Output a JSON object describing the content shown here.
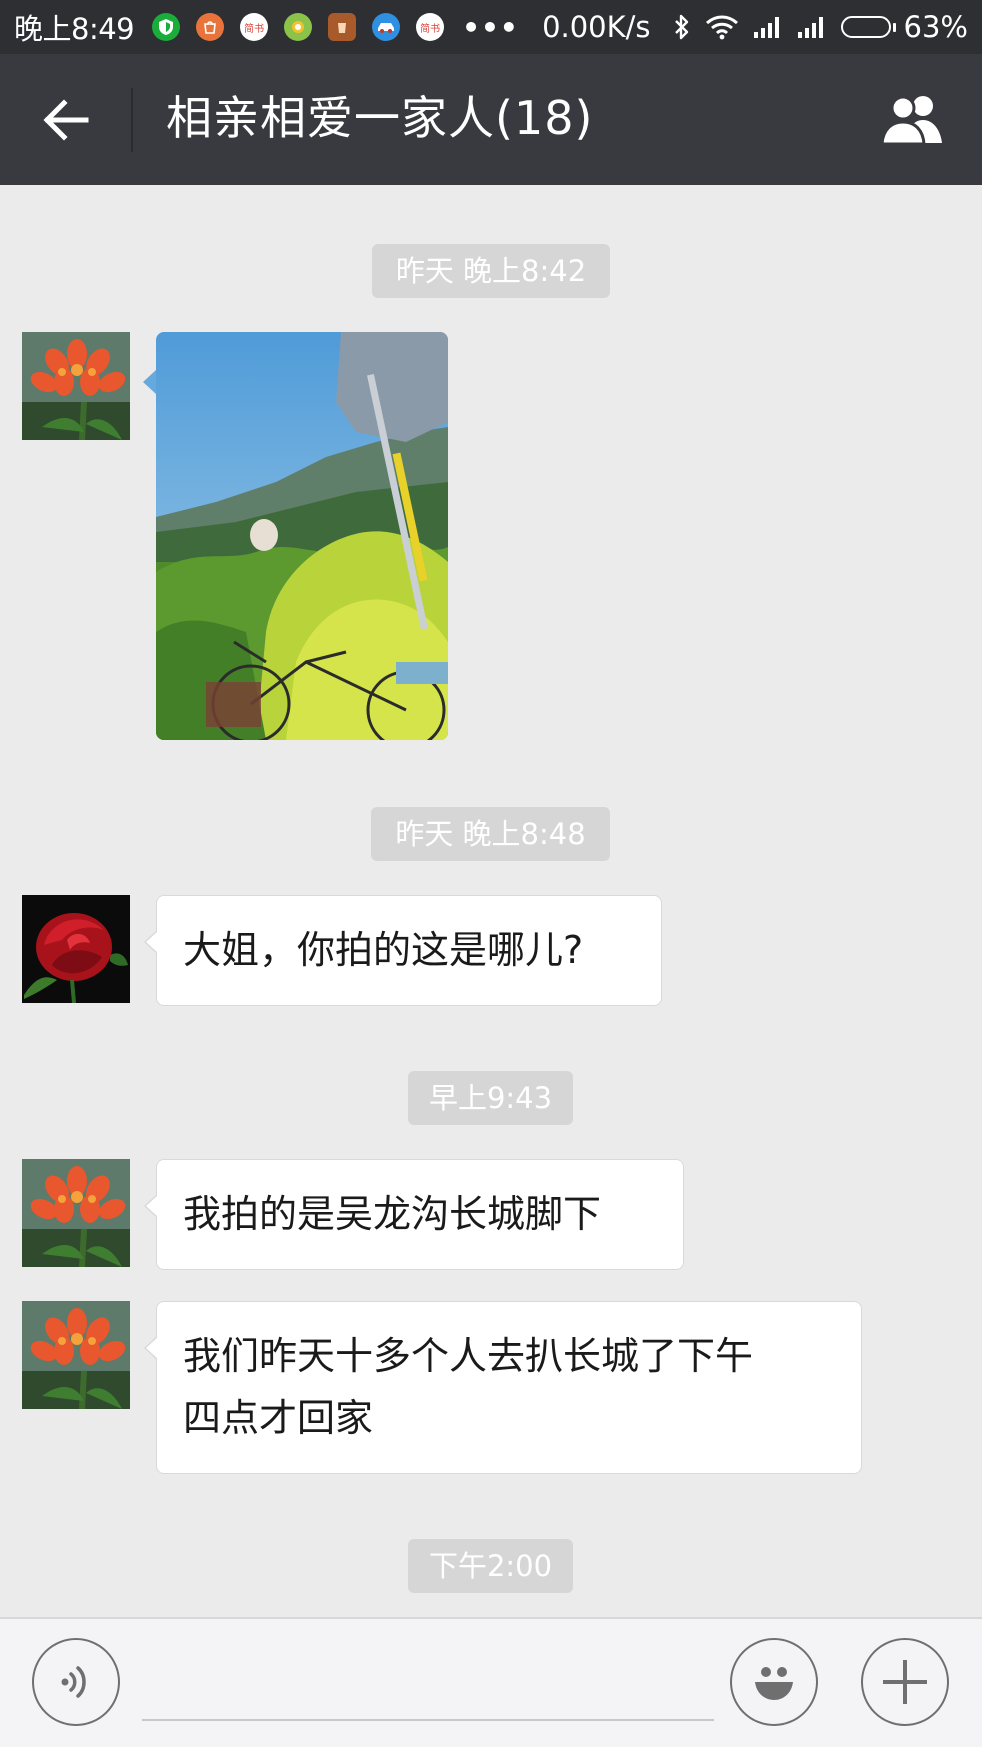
{
  "status_bar": {
    "time": "晚上8:49",
    "notification_icons": [
      {
        "icon": "shield-app-icon",
        "color": "#1aad3a",
        "label": ""
      },
      {
        "icon": "shopping-app-icon",
        "color": "#e8743b",
        "label": ""
      },
      {
        "icon": "jianshu-app-icon",
        "color": "#ffffff",
        "label": "简书"
      },
      {
        "icon": "circle-app-icon",
        "color": "#f2c12e",
        "label": ""
      },
      {
        "icon": "cup-app-icon",
        "color": "#d46a2b",
        "label": ""
      },
      {
        "icon": "car-app-icon",
        "color": "#2f8fe0",
        "label": ""
      },
      {
        "icon": "jianshu-app-icon",
        "color": "#ffffff",
        "label": "简书"
      }
    ],
    "more": "•••",
    "network_speed": "0.00K/s",
    "bluetooth_icon": "bluetooth-icon",
    "wifi_icon": "wifi-icon",
    "signal_icons": [
      "signal-icon",
      "signal-icon"
    ],
    "battery_level": 0.63,
    "battery_percent": "63%"
  },
  "header": {
    "back_icon": "arrow-left-icon",
    "title": "相亲相爱一家人(18)",
    "members_icon": "group-members-icon"
  },
  "chat": {
    "messages": [
      {
        "type": "time",
        "text": "昨天 晚上8:42"
      },
      {
        "type": "image",
        "avatar": "orange-flower-avatar",
        "image": "great-wall-foot-photo"
      },
      {
        "type": "time",
        "text": "昨天 晚上8:48"
      },
      {
        "type": "text",
        "avatar": "red-rose-avatar",
        "text": "大姐，你拍的这是哪儿?"
      },
      {
        "type": "time",
        "text": "早上9:43"
      },
      {
        "type": "text",
        "avatar": "orange-flower-avatar",
        "text": "我拍的是吴龙沟长城脚下"
      },
      {
        "type": "text",
        "avatar": "orange-flower-avatar",
        "text_lines": [
          "我们昨天十多个人去扒长城了下午",
          "四点才回家"
        ]
      },
      {
        "type": "time",
        "text": "下午2:00"
      }
    ]
  },
  "input_bar": {
    "voice_icon": "voice-input-icon",
    "text_value": "",
    "emoji_icon": "emoji-icon",
    "plus_icon": "plus-icon"
  },
  "colors": {
    "status_bar_bg": "#2d2f33",
    "title_bar_bg": "#393a3f",
    "chat_bg": "#ebebeb",
    "time_pill_bg": "#d6d6d6",
    "bubble_bg": "#ffffff"
  }
}
